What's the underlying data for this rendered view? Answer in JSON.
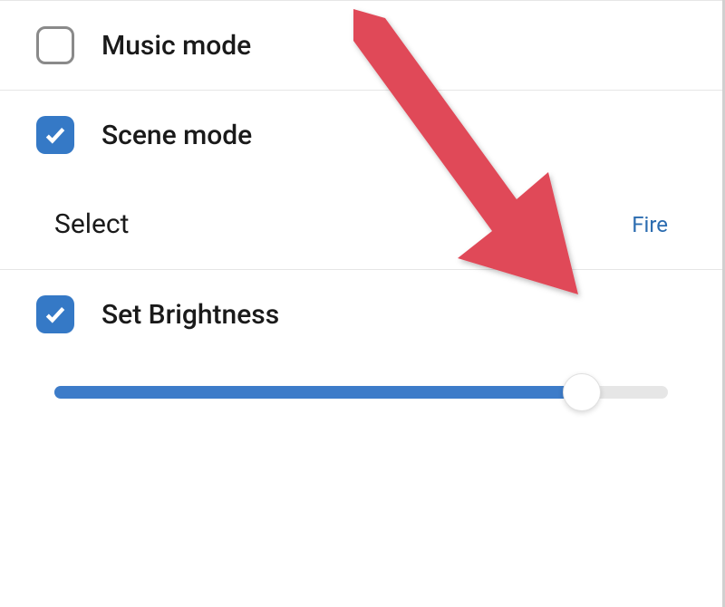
{
  "options": {
    "music_mode": {
      "label": "Music mode",
      "checked": false
    },
    "scene_mode": {
      "label": "Scene mode",
      "checked": true,
      "select": {
        "label": "Select",
        "value": "Fire"
      }
    },
    "brightness": {
      "label": "Set Brightness",
      "checked": true,
      "value_percent": 86
    }
  },
  "colors": {
    "accent": "#3579c6",
    "link": "#2b6cb0",
    "annotation": "#e04a59"
  }
}
